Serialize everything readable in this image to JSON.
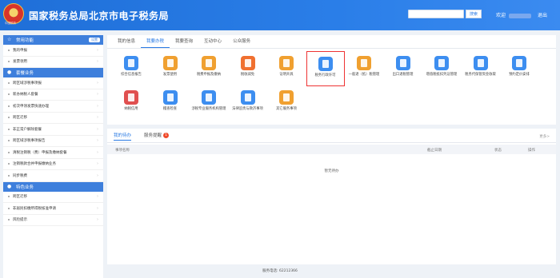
{
  "header": {
    "logo_text": "中国税务",
    "title": "国家税务总局北京市电子税务局",
    "search_button": "搜索",
    "welcome": "欢迎",
    "logout": "退出"
  },
  "sidebar": {
    "sections": [
      {
        "title": "常用功能",
        "settings": "设置",
        "items": [
          "我的申报",
          "发票领用"
        ]
      },
      {
        "title": "套餐业务",
        "items": [
          "跨区域涉税事项报",
          "新办纳税人套餐",
          "初次申领发票快速办理",
          "跨区迁移",
          "非正常户解除套餐",
          "跨区域涉税事项报告",
          "清税注销税（费）申报及缴纳套餐",
          "注销税款合并申报缴纳业务",
          "同步税费"
        ]
      },
      {
        "title": "特色业务",
        "items": [
          "跨区迁移",
          "非居民扣缴所得税核准申请",
          "风险提示"
        ]
      }
    ]
  },
  "main": {
    "tabs": [
      "我的信息",
      "我要办税",
      "我要查询",
      "互动中心",
      "公众服务"
    ],
    "active_tab": "我要办税",
    "tiles": [
      {
        "label": "综合信息报告",
        "icon": "report-icon",
        "color": "#3d8ef0"
      },
      {
        "label": "发票使用",
        "icon": "invoice-icon",
        "color": "#f0a030"
      },
      {
        "label": "税费申报及缴纳",
        "icon": "tax-declare-icon",
        "color": "#f0a030"
      },
      {
        "label": "税收减免",
        "icon": "tax-relief-icon",
        "color": "#f07030"
      },
      {
        "label": "证明开具",
        "icon": "certificate-icon",
        "color": "#f0a030"
      },
      {
        "label": "税务行政许可",
        "icon": "admin-permit-icon",
        "color": "#3d8ef0"
      },
      {
        "label": "一般退（抵）税管理",
        "icon": "refund-icon",
        "color": "#f0a030"
      },
      {
        "label": "出口退税管理",
        "icon": "export-refund-icon",
        "color": "#3d8ef0"
      },
      {
        "label": "增值税抵扣凭证管理",
        "icon": "vat-voucher-icon",
        "color": "#3d8ef0"
      },
      {
        "label": "税务代保管资金收取",
        "icon": "money-bag-icon",
        "color": "#3d8ef0"
      },
      {
        "label": "预约定价安排",
        "icon": "pricing-icon",
        "color": "#3d8ef0"
      },
      {
        "label": "纳税信用",
        "icon": "credit-icon",
        "color": "#e05050"
      },
      {
        "label": "稽查检查",
        "icon": "inspection-icon",
        "color": "#3d8ef0"
      },
      {
        "label": "涉税专业服务机构管理",
        "icon": "agency-icon",
        "color": "#3d8ef0"
      },
      {
        "label": "法律追责与救济事项",
        "icon": "law-icon",
        "color": "#3d8ef0"
      },
      {
        "label": "其它服务事项",
        "icon": "other-service-icon",
        "color": "#f0a030"
      }
    ],
    "highlighted_tile": "税务行政许可"
  },
  "todo": {
    "tabs": [
      "我的待办",
      "服务提醒"
    ],
    "reminder_count": "1",
    "more": "更多>",
    "columns": [
      "事项名称",
      "截止日期",
      "状态",
      "操作"
    ],
    "empty_text": "暂无待办"
  },
  "footer": {
    "text": "服务电话: 62212366"
  }
}
